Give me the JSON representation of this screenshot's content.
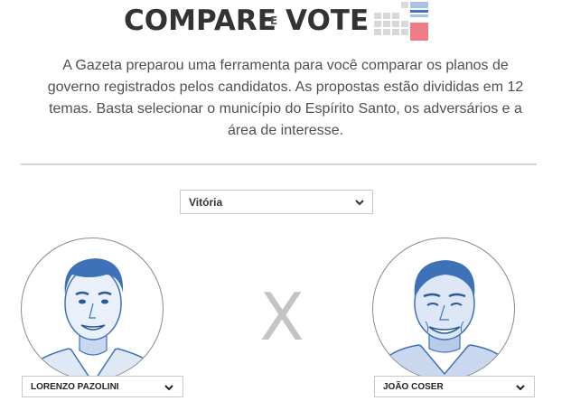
{
  "brand": {
    "word_1": "COMPARE",
    "connector": "E",
    "word_2": "VOTE",
    "icon": "grid-logo-icon",
    "colors": {
      "dark": "#333333",
      "grid": "#d9d9d9",
      "blue": "#3b78b8",
      "light_blue": "#a9c2e2",
      "pink": "#ee7b86"
    }
  },
  "intro": "A Gazeta preparou uma ferramenta para você comparar os planos de governo registrados pelos candidatos. As propostas estão divididas em 12 temas. Basta selecionar o município do Espírito Santo, os adversários e a área de interesse.",
  "city_select": {
    "value": "Vitória",
    "icon": "chevron-down-icon"
  },
  "versus": "X",
  "candidates": [
    {
      "name": "LORENZO PAZOLINI",
      "icon": "chevron-down-icon"
    },
    {
      "name": "JOÃO COSER",
      "icon": "chevron-down-icon"
    }
  ],
  "portrait_tint": "#3d72b8"
}
